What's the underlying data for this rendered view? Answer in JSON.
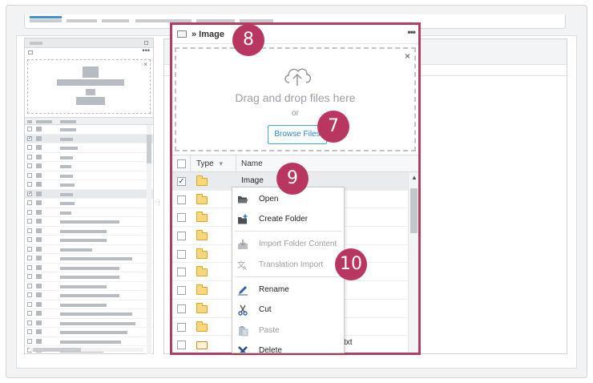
{
  "browser": {
    "path": "» Image",
    "more_icon": "more-horizontal-icon",
    "dropzone": {
      "drag_text": "Drag and drop files here",
      "or_text": "or",
      "browse_label": "Browse Files",
      "close_symbol": "×"
    },
    "columns": {
      "type": "Type",
      "name": "Name"
    },
    "rows": [
      {
        "name": "Image",
        "selected": true,
        "icon": "folder-icon"
      },
      {
        "name": "",
        "selected": false,
        "icon": "folder-icon"
      },
      {
        "name": "",
        "selected": false,
        "icon": "folder-icon"
      },
      {
        "name": "",
        "selected": false,
        "icon": "folder-icon"
      },
      {
        "name": "",
        "selected": false,
        "icon": "folder-icon"
      },
      {
        "name": "",
        "selected": false,
        "icon": "folder-icon"
      },
      {
        "name": "",
        "selected": false,
        "icon": "folder-icon"
      },
      {
        "name": "",
        "selected": false,
        "icon": "folder-icon"
      },
      {
        "name": "",
        "selected": false,
        "icon": "folder-icon"
      },
      {
        "name": "txt",
        "selected": false,
        "icon": "file-icon"
      }
    ]
  },
  "context_menu": {
    "items": [
      {
        "label": "Open",
        "icon": "open-folder-icon",
        "enabled": true
      },
      {
        "label": "Create Folder",
        "icon": "create-folder-icon",
        "enabled": true
      },
      {
        "label": "Import Folder Content",
        "icon": "import-icon",
        "enabled": false
      },
      {
        "label": "Translation Import",
        "icon": "translate-icon",
        "enabled": false
      },
      {
        "label": "Rename",
        "icon": "rename-icon",
        "enabled": true
      },
      {
        "label": "Cut",
        "icon": "scissors-icon",
        "enabled": true
      },
      {
        "label": "Paste",
        "icon": "paste-icon",
        "enabled": false
      },
      {
        "label": "Delete",
        "icon": "delete-icon",
        "enabled": true
      }
    ]
  },
  "callouts": {
    "c8": "8",
    "c7": "7",
    "c9": "9",
    "c10": "10"
  },
  "colors": {
    "highlight": "#b13d63",
    "badge": "#b8365f",
    "link": "#2a86c5"
  }
}
